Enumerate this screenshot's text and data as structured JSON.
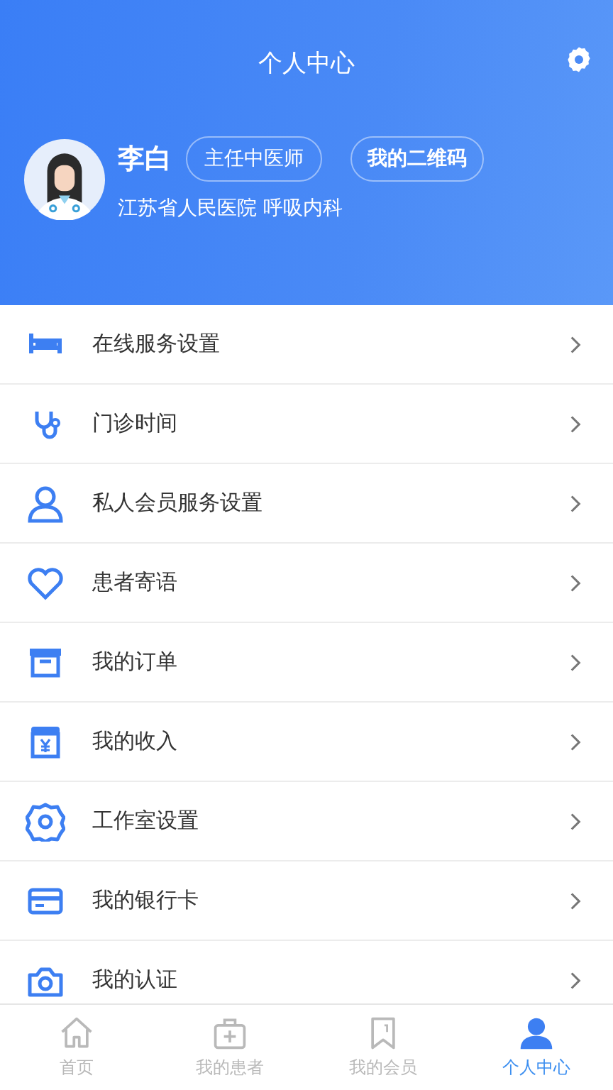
{
  "header": {
    "title": "个人中心"
  },
  "profile": {
    "name": "李白",
    "title_badge": "主任中医师",
    "qr_button": "我的二维码",
    "affiliation": "江苏省人民医院 呼吸内科"
  },
  "menu": [
    {
      "label": "在线服务设置"
    },
    {
      "label": "门诊时间"
    },
    {
      "label": "私人会员服务设置"
    },
    {
      "label": "患者寄语"
    },
    {
      "label": "我的订单"
    },
    {
      "label": "我的收入"
    },
    {
      "label": "工作室设置"
    },
    {
      "label": "我的银行卡"
    },
    {
      "label": "我的认证"
    }
  ],
  "tabs": [
    {
      "label": "首页",
      "selected": false
    },
    {
      "label": "我的患者",
      "selected": false
    },
    {
      "label": "我的会员",
      "selected": false
    },
    {
      "label": "个人中心",
      "selected": true
    }
  ]
}
